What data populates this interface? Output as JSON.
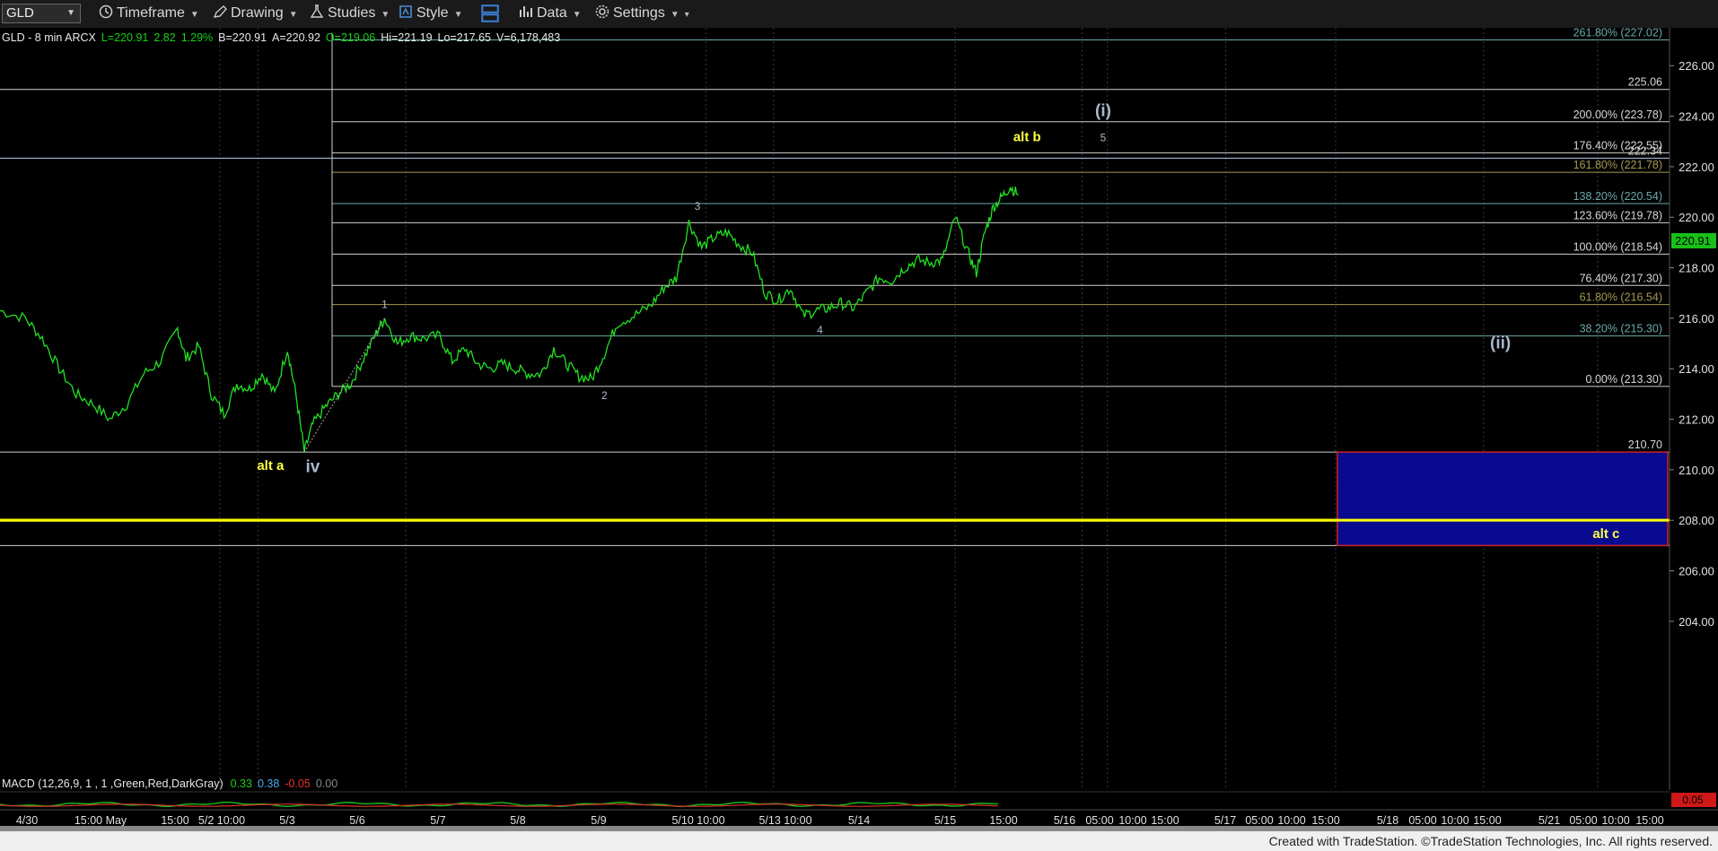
{
  "toolbar": {
    "symbol": "GLD",
    "timeframe_label": "Timeframe",
    "drawing_label": "Drawing",
    "studies_label": "Studies",
    "style_label": "Style",
    "data_label": "Data",
    "settings_label": "Settings"
  },
  "header": {
    "symbol_line": "GLD - 8 min  ARCX",
    "last": "L=220.91",
    "change": "2.82",
    "pct": "1.29%",
    "bid": "B=220.91",
    "ask": "A=220.92",
    "open": "O=219.06",
    "high": "Hi=221.19",
    "low": "Lo=217.65",
    "volume": "V=6,178,483"
  },
  "chart_data": {
    "type": "line",
    "ylim": [
      203,
      227.5
    ],
    "yticks": [
      "226.00",
      "224.00",
      "222.00",
      "220.00",
      "218.00",
      "216.00",
      "214.00",
      "212.00",
      "210.00",
      "208.00",
      "206.00",
      "204.00"
    ],
    "last_price": "220.91",
    "x_labels": [
      "4/30",
      "15:00 May",
      "15:00",
      "5/2 10:00",
      "5/3",
      "5/6",
      "5/7",
      "5/8",
      "5/9",
      "5/10 10:00",
      "5/13 10:00",
      "5/14",
      "5/15",
      "15:00",
      "5/16",
      "05:00",
      "10:00",
      "15:00",
      "5/17",
      "05:00",
      "10:00",
      "15:00",
      "5/18",
      "05:00",
      "10:00",
      "15:00",
      "5/21",
      "05:00",
      "10:00",
      "15:00"
    ],
    "price_series": [
      {
        "t": 0,
        "p": 216.3
      },
      {
        "t": 6,
        "p": 216.0
      },
      {
        "t": 10,
        "p": 215.2
      },
      {
        "t": 14,
        "p": 214.0
      },
      {
        "t": 18,
        "p": 213.0
      },
      {
        "t": 22,
        "p": 212.6
      },
      {
        "t": 26,
        "p": 212.0
      },
      {
        "t": 30,
        "p": 212.6
      },
      {
        "t": 34,
        "p": 213.8
      },
      {
        "t": 38,
        "p": 214.3
      },
      {
        "t": 42,
        "p": 215.6
      },
      {
        "t": 44,
        "p": 214.4
      },
      {
        "t": 47,
        "p": 214.9
      },
      {
        "t": 50,
        "p": 213.0
      },
      {
        "t": 53,
        "p": 212.2
      },
      {
        "t": 56,
        "p": 213.4
      },
      {
        "t": 59,
        "p": 213.2
      },
      {
        "t": 62,
        "p": 213.8
      },
      {
        "t": 65,
        "p": 213.0
      },
      {
        "t": 68,
        "p": 214.8
      },
      {
        "t": 70,
        "p": 213.0
      },
      {
        "t": 72,
        "p": 210.7
      },
      {
        "t": 74,
        "p": 211.8
      },
      {
        "t": 77,
        "p": 212.5
      },
      {
        "t": 80,
        "p": 213.0
      },
      {
        "t": 83,
        "p": 213.4
      },
      {
        "t": 86,
        "p": 214.4
      },
      {
        "t": 89,
        "p": 215.4
      },
      {
        "t": 91,
        "p": 216.0
      },
      {
        "t": 94,
        "p": 215.0
      },
      {
        "t": 97,
        "p": 215.3
      },
      {
        "t": 100,
        "p": 215.2
      },
      {
        "t": 104,
        "p": 215.3
      },
      {
        "t": 107,
        "p": 214.3
      },
      {
        "t": 110,
        "p": 214.8
      },
      {
        "t": 113,
        "p": 214.2
      },
      {
        "t": 116,
        "p": 214.0
      },
      {
        "t": 119,
        "p": 214.2
      },
      {
        "t": 122,
        "p": 214.0
      },
      {
        "t": 125,
        "p": 213.8
      },
      {
        "t": 128,
        "p": 213.8
      },
      {
        "t": 131,
        "p": 214.8
      },
      {
        "t": 134,
        "p": 214.2
      },
      {
        "t": 137,
        "p": 213.7
      },
      {
        "t": 140,
        "p": 213.6
      },
      {
        "t": 143,
        "p": 214.6
      },
      {
        "t": 146,
        "p": 215.8
      },
      {
        "t": 150,
        "p": 216.1
      },
      {
        "t": 154,
        "p": 216.5
      },
      {
        "t": 157,
        "p": 217.2
      },
      {
        "t": 160,
        "p": 217.6
      },
      {
        "t": 163,
        "p": 219.8
      },
      {
        "t": 166,
        "p": 218.8
      },
      {
        "t": 169,
        "p": 219.2
      },
      {
        "t": 172,
        "p": 219.4
      },
      {
        "t": 175,
        "p": 218.9
      },
      {
        "t": 178,
        "p": 218.6
      },
      {
        "t": 181,
        "p": 217.0
      },
      {
        "t": 184,
        "p": 216.7
      },
      {
        "t": 187,
        "p": 217.2
      },
      {
        "t": 190,
        "p": 216.1
      },
      {
        "t": 193,
        "p": 216.3
      },
      {
        "t": 196,
        "p": 216.4
      },
      {
        "t": 199,
        "p": 216.6
      },
      {
        "t": 202,
        "p": 216.4
      },
      {
        "t": 205,
        "p": 217.0
      },
      {
        "t": 208,
        "p": 217.6
      },
      {
        "t": 211,
        "p": 217.5
      },
      {
        "t": 214,
        "p": 218.0
      },
      {
        "t": 217,
        "p": 218.3
      },
      {
        "t": 220,
        "p": 218.2
      },
      {
        "t": 223,
        "p": 218.3
      },
      {
        "t": 226,
        "p": 220.0
      },
      {
        "t": 229,
        "p": 218.6
      },
      {
        "t": 231,
        "p": 217.8
      },
      {
        "t": 233,
        "p": 219.4
      },
      {
        "t": 235,
        "p": 220.4
      },
      {
        "t": 237,
        "p": 220.8
      },
      {
        "t": 239,
        "p": 221.2
      },
      {
        "t": 241,
        "p": 220.9
      }
    ],
    "fib_levels": [
      {
        "label": "261.80% (227.02)",
        "value": 227.02,
        "color": "#6aa9a8"
      },
      {
        "label": "225.06",
        "value": 225.06,
        "color": "#d0d0d0"
      },
      {
        "label": "200.00% (223.78)",
        "value": 223.78,
        "color": "#d0d0d0"
      },
      {
        "label": "176.40% (222.55)",
        "value": 222.55,
        "color": "#d0d0d0"
      },
      {
        "label": "222.34",
        "value": 222.34,
        "color": "#b8c8f0"
      },
      {
        "label": "161.80% (221.78)",
        "value": 221.78,
        "color": "#a39a52"
      },
      {
        "label": "138.20% (220.54)",
        "value": 220.54,
        "color": "#6aa9a8"
      },
      {
        "label": "123.60% (219.78)",
        "value": 219.78,
        "color": "#d0d0d0"
      },
      {
        "label": "100.00% (218.54)",
        "value": 218.54,
        "color": "#d0d0d0"
      },
      {
        "label": "76.40% (217.30)",
        "value": 217.3,
        "color": "#d0d0d0"
      },
      {
        "label": "61.80% (216.54)",
        "value": 216.54,
        "color": "#a39a52"
      },
      {
        "label": "38.20% (215.30)",
        "value": 215.3,
        "color": "#6aa9a8"
      },
      {
        "label": "0.00% (213.30)",
        "value": 213.3,
        "color": "#d0d0d0"
      },
      {
        "label": "210.70",
        "value": 210.7,
        "color": "#d0d0d0"
      },
      {
        "label": "208.00",
        "value": 208.0,
        "color": "#ffff00"
      },
      {
        "label": "207.00",
        "value": 207.0,
        "color": "#d0d0d0"
      }
    ],
    "target_box": {
      "top": 210.7,
      "bottom": 207.0,
      "fill": "#0a0a90",
      "border": "#cc2222"
    },
    "wave_labels": [
      {
        "text": "1",
        "t": 91,
        "p": 216.4,
        "color": "#aab8cc",
        "size": "small"
      },
      {
        "text": "2",
        "t": 143,
        "p": 212.8,
        "color": "#aab8cc",
        "size": "small"
      },
      {
        "text": "3",
        "t": 165,
        "p": 220.3,
        "color": "#aab8cc",
        "size": "small"
      },
      {
        "text": "4",
        "t": 194,
        "p": 215.4,
        "color": "#aab8cc",
        "size": "small"
      },
      {
        "text": "5",
        "t": 261,
        "p": 223.0,
        "color": "#aab8cc",
        "size": "small"
      },
      {
        "text": "(i)",
        "t": 261,
        "p": 224.0,
        "color": "#aab8cc",
        "size": "big"
      },
      {
        "text": "(ii)",
        "t": 355,
        "p": 214.8,
        "color": "#aab8cc",
        "size": "big"
      },
      {
        "text": "iv",
        "t": 74,
        "p": 209.9,
        "color": "#aab8cc",
        "size": "big"
      },
      {
        "text": "alt a",
        "t": 64,
        "p": 210.0,
        "color": "#ffff44",
        "size": "mid"
      },
      {
        "text": "alt b",
        "t": 243,
        "p": 223.0,
        "color": "#ffff44",
        "size": "mid"
      },
      {
        "text": "alt c",
        "t": 380,
        "p": 207.3,
        "color": "#ffff44",
        "size": "mid"
      }
    ],
    "macd": {
      "label": "MACD (12,26,9, 1 , 1 ,Green,Red,DarkGray)",
      "v1": "0.33",
      "v2": "0.38",
      "v3": "-0.05",
      "v4": "0.00",
      "axis_value": "0.05"
    }
  },
  "footer": {
    "credit": "Created with TradeStation. ©TradeStation Technologies, Inc. All rights reserved."
  }
}
